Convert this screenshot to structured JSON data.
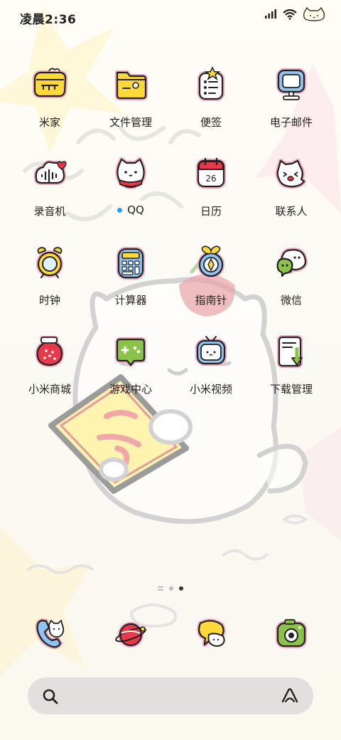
{
  "status": {
    "time": "凌晨2:36"
  },
  "apps": [
    {
      "label": "米家",
      "icon": "mijia-icon"
    },
    {
      "label": "文件管理",
      "icon": "folder-icon"
    },
    {
      "label": "便签",
      "icon": "notes-icon"
    },
    {
      "label": "电子邮件",
      "icon": "email-icon"
    },
    {
      "label": "录音机",
      "icon": "recorder-icon"
    },
    {
      "label": "QQ",
      "icon": "qq-icon",
      "has_notification_dot": true
    },
    {
      "label": "日历",
      "icon": "calendar-icon",
      "icon_text": "26"
    },
    {
      "label": "联系人",
      "icon": "contacts-icon"
    },
    {
      "label": "时钟",
      "icon": "clock-icon"
    },
    {
      "label": "计算器",
      "icon": "calculator-icon"
    },
    {
      "label": "指南针",
      "icon": "compass-icon"
    },
    {
      "label": "微信",
      "icon": "wechat-icon"
    },
    {
      "label": "小米商城",
      "icon": "mi-store-icon"
    },
    {
      "label": "游戏中心",
      "icon": "game-center-icon"
    },
    {
      "label": "小米视频",
      "icon": "mi-video-icon"
    },
    {
      "label": "下载管理",
      "icon": "download-icon"
    }
  ],
  "pager": {
    "pages": 2,
    "current": 2
  },
  "dock": [
    {
      "icon": "phone-icon"
    },
    {
      "icon": "browser-icon"
    },
    {
      "icon": "messages-icon"
    },
    {
      "icon": "camera-icon"
    }
  ],
  "search": {
    "icon": "search-icon",
    "assistant_icon": "assistant-icon"
  },
  "colors": {
    "yellow": "#ffd93a",
    "pink_outline": "#f2a7c0",
    "red": "#e8394a",
    "blue": "#8fc3f0",
    "green": "#8bc34a"
  }
}
